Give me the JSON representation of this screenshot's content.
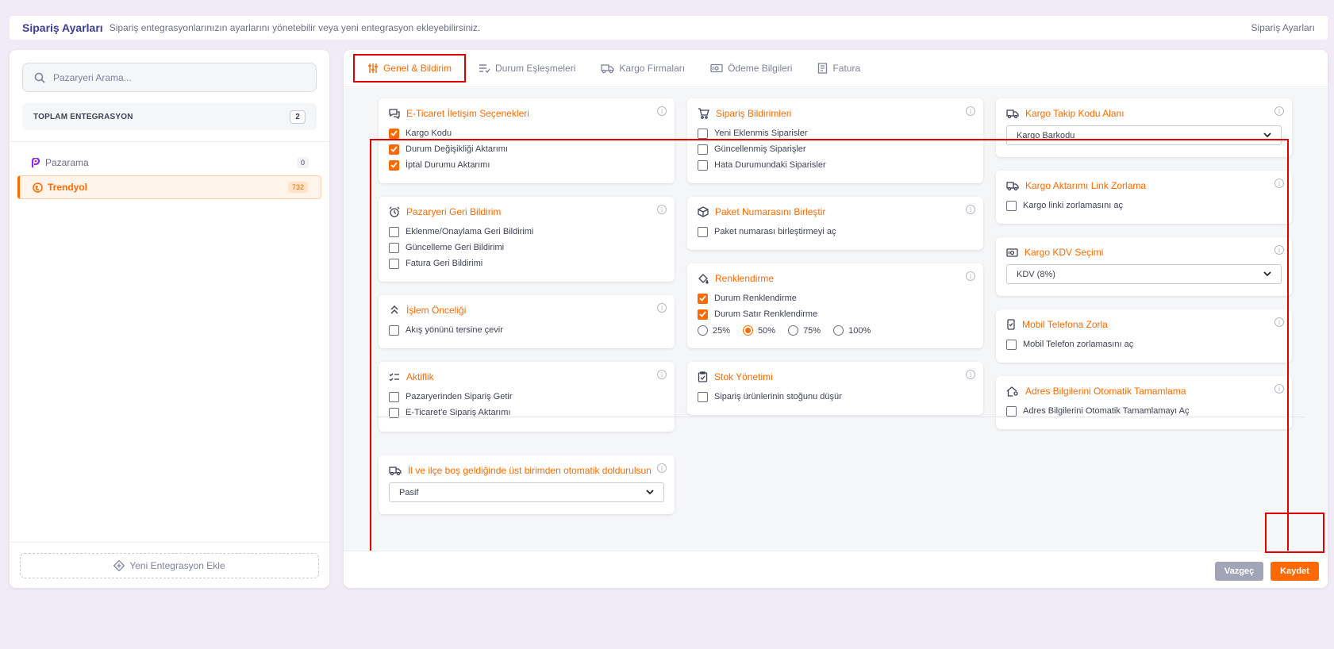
{
  "header": {
    "title": "Sipariş Ayarları",
    "description": "Sipariş entegrasyonlarınızın ayarlarını yönetebilir veya yeni entegrasyon ekleyebilirsiniz.",
    "breadcrumb": "Sipariş Ayarları"
  },
  "sidebar": {
    "search_placeholder": "Pazaryeri Arama...",
    "total_label": "TOPLAM ENTEGRASYON",
    "total_count": "2",
    "items": [
      {
        "label": "Pazarama",
        "count": "0",
        "icon": "pazarama-logo-icon"
      },
      {
        "label": "Trendyol",
        "count": "732",
        "icon": "trendyol-logo-icon"
      }
    ],
    "add_button": "Yeni Entegrasyon Ekle"
  },
  "tabs": [
    {
      "label": "Genel & Bildirim",
      "icon": "sliders-icon"
    },
    {
      "label": "Durum Eşleşmeleri",
      "icon": "list-icon"
    },
    {
      "label": "Kargo Firmaları",
      "icon": "truck-icon"
    },
    {
      "label": "Ödeme Bilgileri",
      "icon": "money-icon"
    },
    {
      "label": "Fatura",
      "icon": "invoice-icon"
    }
  ],
  "cards": {
    "eticaret": {
      "title": "E-Ticaret İletişim Seçenekleri",
      "options": [
        {
          "label": "Kargo Kodu",
          "checked": true
        },
        {
          "label": "Durum Değişikliği Aktarımı",
          "checked": true
        },
        {
          "label": "İptal Durumu Aktarımı",
          "checked": true
        }
      ]
    },
    "pazaryeri": {
      "title": "Pazaryeri Geri Bildirim",
      "options": [
        {
          "label": "Eklenme/Onaylama Geri Bildirimi",
          "checked": false
        },
        {
          "label": "Güncelleme Geri Bildirimi",
          "checked": false
        },
        {
          "label": "Fatura Geri Bildirimi",
          "checked": false
        }
      ]
    },
    "islem": {
      "title": "İşlem Önceliği",
      "options": [
        {
          "label": "Akış yönünü tersine çevir",
          "checked": false
        }
      ]
    },
    "aktiflik": {
      "title": "Aktiflik",
      "options": [
        {
          "label": "Pazaryerinden Sipariş Getir",
          "checked": false
        },
        {
          "label": "E-Ticaret'e Sipariş Aktarımı",
          "checked": false
        }
      ]
    },
    "siparis": {
      "title": "Sipariş Bildirimleri",
      "options": [
        {
          "label": "Yeni Eklenmis Siparisler",
          "checked": false
        },
        {
          "label": "Güncellenmiş Siparişler",
          "checked": false
        },
        {
          "label": "Hata Durumundaki Siparisler",
          "checked": false
        }
      ]
    },
    "paket": {
      "title": "Paket Numarasını Birleştir",
      "options": [
        {
          "label": "Paket numarası birleştirmeyi aç",
          "checked": false
        }
      ]
    },
    "renk": {
      "title": "Renklendirme",
      "options": [
        {
          "label": "Durum Renklendirme",
          "checked": true
        },
        {
          "label": "Durum Satır Renklendirme",
          "checked": true
        }
      ],
      "radios": [
        "25%",
        "50%",
        "75%",
        "100%"
      ],
      "selected_radio": "50%"
    },
    "stok": {
      "title": "Stok Yönetimi",
      "options": [
        {
          "label": "Sipariş ürünlerinin stoğunu düşür",
          "checked": false
        }
      ]
    },
    "kargotakip": {
      "title": "Kargo Takip Kodu Alanı",
      "select_value": "Kargo Barkodu"
    },
    "kargolink": {
      "title": "Kargo Aktarımı Link Zorlama",
      "options": [
        {
          "label": "Kargo linki zorlamasını aç",
          "checked": false
        }
      ]
    },
    "kdv": {
      "title": "Kargo KDV Seçimi",
      "select_value": "KDV (8%)"
    },
    "mobil": {
      "title": "Mobil Telefona Zorla",
      "options": [
        {
          "label": "Mobil Telefon zorlamasını aç",
          "checked": false
        }
      ]
    },
    "adres": {
      "title": "Adres Bilgilerini Otomatik Tamamlama",
      "options": [
        {
          "label": "Adres Bilgilerini Otomatik Tamamlamayı Aç",
          "checked": false
        }
      ]
    },
    "il": {
      "title": "İl ve ilçe boş geldiğinde üst birimden otomatik doldurulsun",
      "select_value": "Pasif"
    }
  },
  "footer": {
    "cancel": "Vazgeç",
    "save": "Kaydet"
  },
  "colors": {
    "accent": "#ff6a00",
    "highlight": "#e00000",
    "brand": "#3b3f8f"
  }
}
